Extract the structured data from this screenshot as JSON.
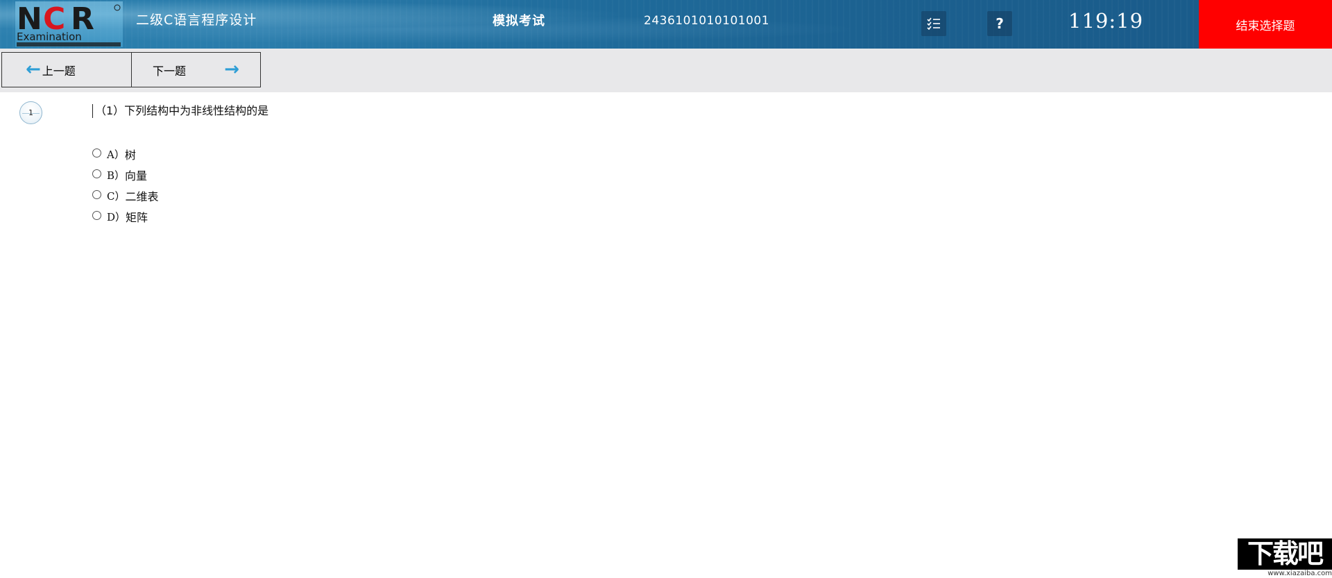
{
  "header": {
    "logo_text": "NCR",
    "logo_subtext": "Examination",
    "subject": "二级C语言程序设计",
    "exam_mode": "模拟考试",
    "exam_id": "2436101010101001",
    "list_icon": "checklist-icon",
    "help_label": "?",
    "timer": "119:19",
    "end_button": "结束选择题",
    "accent_color": "#ff0000"
  },
  "toolbar": {
    "prev_label": "上一题",
    "next_label": "下一题",
    "prev_icon": "arrow-left-icon",
    "next_icon": "arrow-right-icon"
  },
  "question": {
    "number": "1",
    "text": "（1）下列结构中为非线性结构的是",
    "options": [
      {
        "letter": "A）",
        "text": "树"
      },
      {
        "letter": "B）",
        "text": "向量"
      },
      {
        "letter": "C）",
        "text": "二维表"
      },
      {
        "letter": "D）",
        "text": "矩阵"
      }
    ]
  },
  "watermark": {
    "title": "下载吧",
    "url": "www.xiazaiba.com"
  }
}
